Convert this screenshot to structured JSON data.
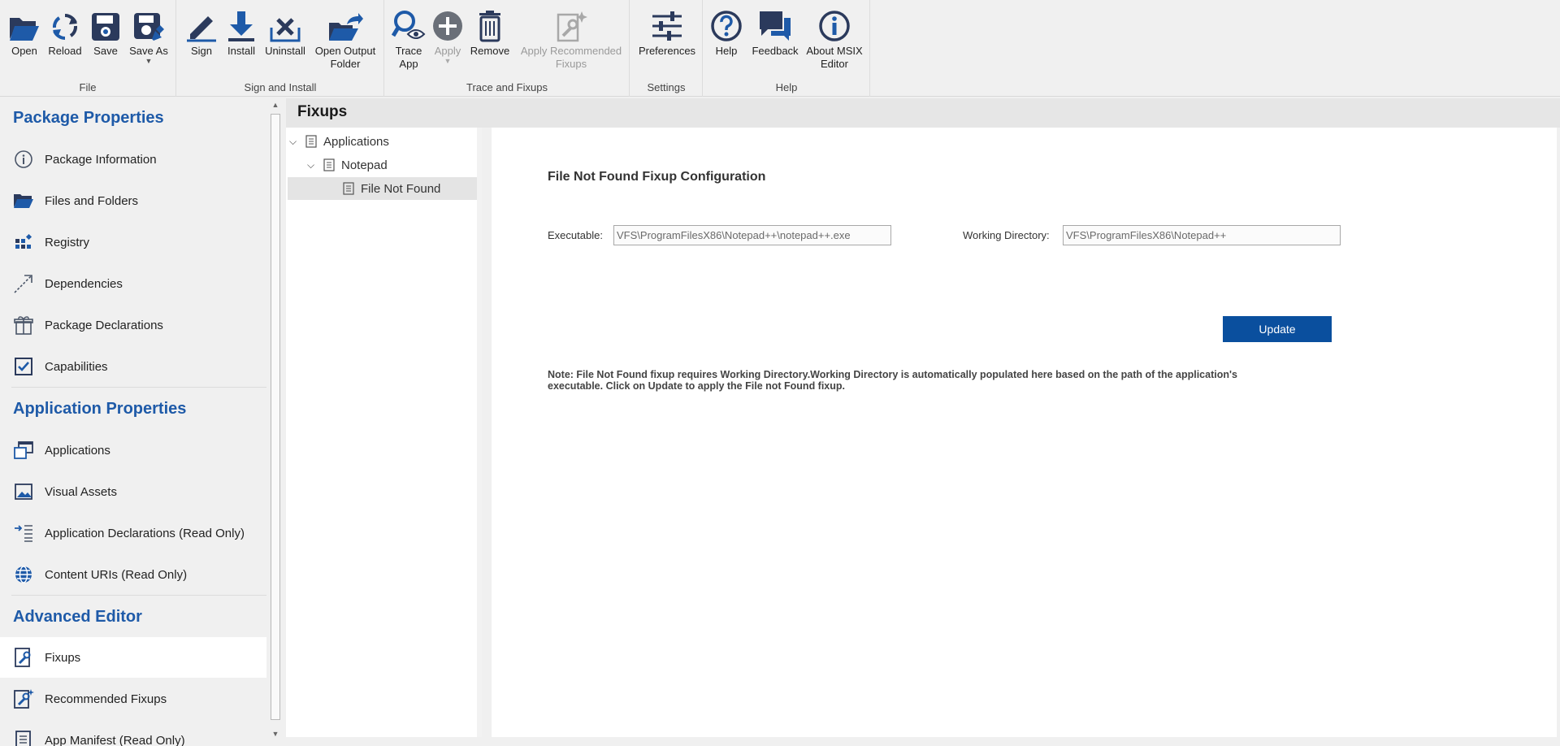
{
  "ribbon": {
    "groups": {
      "file": "File",
      "sign_install": "Sign and Install",
      "trace_fixups": "Trace and Fixups",
      "settings": "Settings",
      "help": "Help"
    },
    "buttons": {
      "open": "Open",
      "reload": "Reload",
      "save": "Save",
      "save_as": "Save As",
      "sign": "Sign",
      "install": "Install",
      "uninstall": "Uninstall",
      "open_output_folder": "Open Output\nFolder",
      "trace_app": "Trace\nApp",
      "apply": "Apply",
      "remove": "Remove",
      "apply_recommended": "Apply Recommended\nFixups",
      "preferences": "Preferences",
      "help": "Help",
      "feedback": "Feedback",
      "about": "About MSIX\nEditor"
    },
    "colors": {
      "accent": "#1e5aa8",
      "icon": "#2b3a5c",
      "disabled": "#a0a0a0"
    }
  },
  "sidebar": {
    "package_properties": {
      "title": "Package Properties",
      "items": [
        {
          "label": "Package Information",
          "icon": "info-icon"
        },
        {
          "label": "Files and Folders",
          "icon": "folder-icon"
        },
        {
          "label": "Registry",
          "icon": "registry-icon"
        },
        {
          "label": "Dependencies",
          "icon": "dependency-arrow-icon"
        },
        {
          "label": "Package Declarations",
          "icon": "gift-icon"
        },
        {
          "label": "Capabilities",
          "icon": "checkbox-icon"
        }
      ]
    },
    "application_properties": {
      "title": "Application Properties",
      "items": [
        {
          "label": "Applications",
          "icon": "window-icon"
        },
        {
          "label": "Visual Assets",
          "icon": "image-icon"
        },
        {
          "label": "Application Declarations (Read Only)",
          "icon": "declarations-icon"
        },
        {
          "label": "Content URIs (Read Only)",
          "icon": "globe-icon"
        }
      ]
    },
    "advanced_editor": {
      "title": "Advanced Editor",
      "items": [
        {
          "label": "Fixups",
          "icon": "fixup-icon",
          "active": true
        },
        {
          "label": "Recommended Fixups",
          "icon": "recommended-fixup-icon"
        },
        {
          "label": "App Manifest (Read Only)",
          "icon": "manifest-icon"
        }
      ]
    }
  },
  "main": {
    "title": "Fixups",
    "tree": {
      "root": "Applications",
      "app": "Notepad",
      "fixup": "File Not Found"
    },
    "config": {
      "title": "File Not Found Fixup Configuration",
      "executable_label": "Executable:",
      "executable_value": "VFS\\ProgramFilesX86\\Notepad++\\notepad++.exe",
      "working_dir_label": "Working Directory:",
      "working_dir_value": "VFS\\ProgramFilesX86\\Notepad++",
      "update_label": "Update",
      "note": "Note: File Not Found fixup requires Working Directory.Working Directory is automatically populated here based on the path of the application's executable. Click on Update to apply the File not Found fixup."
    }
  }
}
